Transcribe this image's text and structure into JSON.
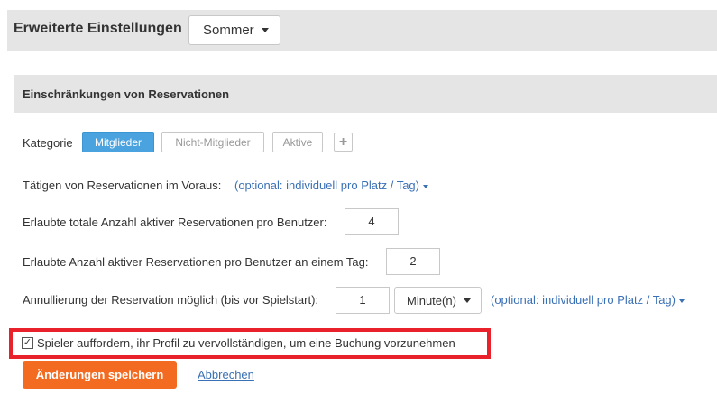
{
  "header": {
    "title": "Erweiterte Einstellungen",
    "season_value": "Sommer"
  },
  "section": {
    "title": "Einschränkungen von Reservationen"
  },
  "category": {
    "label": "Kategorie",
    "pills": [
      "Mitglieder",
      "Nicht-Mitglieder",
      "Aktive"
    ],
    "active_index": 0,
    "add_icon": "plus-icon"
  },
  "advance": {
    "label": "Tätigen von Reservationen im Voraus:",
    "optional_link": "(optional: individuell pro Platz / Tag)"
  },
  "total_active": {
    "label": "Erlaubte totale Anzahl aktiver Reservationen pro Benutzer:",
    "value": "4"
  },
  "per_day": {
    "label": "Erlaubte Anzahl aktiver Reservationen pro Benutzer an einem Tag:",
    "value": "2"
  },
  "cancellation": {
    "label": "Annullierung der Reservation möglich (bis vor Spielstart):",
    "value": "1",
    "unit": "Minute(n)",
    "optional_link": "(optional: individuell pro Platz / Tag)"
  },
  "profile_prompt": {
    "checked": true,
    "label": "Spieler auffordern, ihr Profil zu vervollständigen, um eine Buchung vorzunehmen"
  },
  "actions": {
    "save_label": "Änderungen speichern",
    "cancel_label": "Abbrechen"
  },
  "colors": {
    "accent_blue": "#4aa3df",
    "save_orange": "#f26b21",
    "highlight_red": "#e8212a",
    "link_blue": "#3a70b5"
  }
}
